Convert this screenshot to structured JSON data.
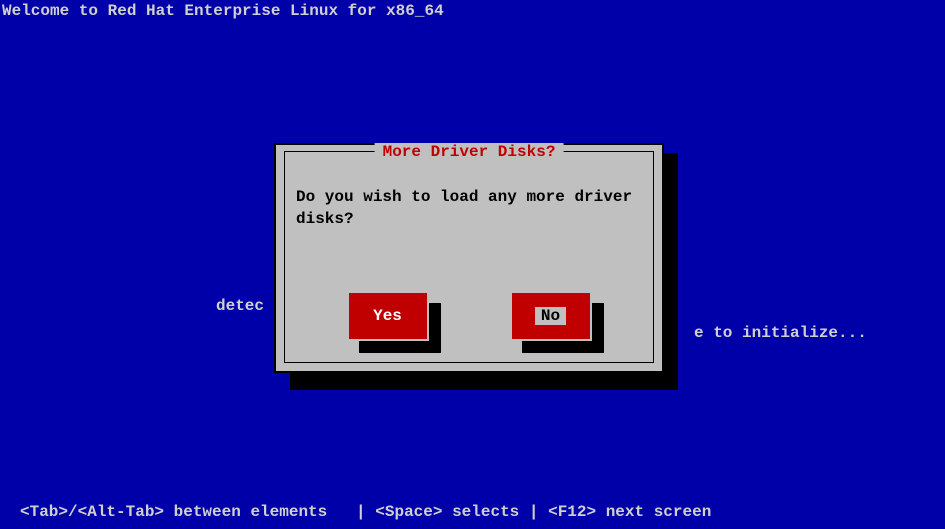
{
  "header": "Welcome to Red Hat Enterprise Linux for x86_64",
  "background": {
    "left_fragment": "detec",
    "right_fragment": "e to initialize..."
  },
  "dialog": {
    "title": "More Driver Disks?",
    "message": "Do you wish to load any more driver disks?",
    "buttons": {
      "yes": "Yes",
      "no": "No"
    }
  },
  "footer": "<Tab>/<Alt-Tab> between elements   | <Space> selects | <F12> next screen"
}
